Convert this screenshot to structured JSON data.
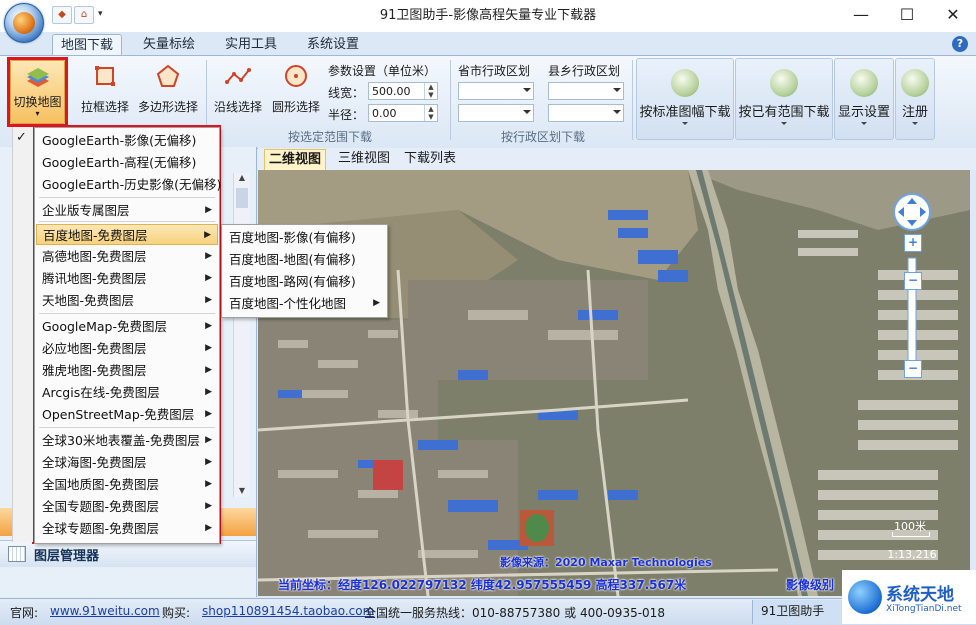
{
  "window": {
    "title": "91卫图助手-影像高程矢量专业下载器",
    "minimize": "—",
    "maximize": "☐",
    "close": "✕"
  },
  "tabs": [
    {
      "label": "地图下载",
      "active": true
    },
    {
      "label": "矢量标绘",
      "active": false
    },
    {
      "label": "实用工具",
      "active": false
    },
    {
      "label": "系统设置",
      "active": false
    }
  ],
  "ribbon": {
    "switch_map": "切换地图",
    "rect_select": "拉框选择",
    "polygon_select": "多边形选择",
    "line_select": "沿线选择",
    "circle_select": "圆形选择",
    "params_title": "参数设置（单位米）",
    "line_width_label": "线宽：",
    "line_width_value": "500.00",
    "radius_label": "半径：",
    "radius_value": "0.00",
    "group_range": "按选定范围下载",
    "province_label": "省市行政区划",
    "county_label": "县乡行政区划",
    "group_admin": "按行政区划下载",
    "btn_standard": "按标准图幅下载",
    "btn_existing": "按已有范围下载",
    "btn_display": "显示设置",
    "btn_logout": "注册"
  },
  "map_tabs": [
    "二维视图",
    "三维视图",
    "下载列表"
  ],
  "menu": {
    "items": [
      {
        "label": "GoogleEarth-影像(无偏移)",
        "checked": true,
        "submenu": false
      },
      {
        "label": "GoogleEarth-高程(无偏移)",
        "checked": false,
        "submenu": false
      },
      {
        "label": "GoogleEarth-历史影像(无偏移)",
        "checked": false,
        "submenu": false
      },
      {
        "label": "企业版专属图层",
        "checked": false,
        "submenu": true
      },
      {
        "label": "百度地图-免费图层",
        "checked": false,
        "submenu": true,
        "highlighted": true
      },
      {
        "label": "高德地图-免费图层",
        "checked": false,
        "submenu": true
      },
      {
        "label": "腾讯地图-免费图层",
        "checked": false,
        "submenu": true
      },
      {
        "label": "天地图-免费图层",
        "checked": false,
        "submenu": true
      },
      {
        "label": "GoogleMap-免费图层",
        "checked": false,
        "submenu": true
      },
      {
        "label": "必应地图-免费图层",
        "checked": false,
        "submenu": true
      },
      {
        "label": "雅虎地图-免费图层",
        "checked": false,
        "submenu": true
      },
      {
        "label": "Arcgis在线-免费图层",
        "checked": false,
        "submenu": true
      },
      {
        "label": "OpenStreetMap-免费图层",
        "checked": false,
        "submenu": true
      },
      {
        "label": "全球30米地表覆盖-免费图层",
        "checked": false,
        "submenu": true
      },
      {
        "label": "全球海图-免费图层",
        "checked": false,
        "submenu": true
      },
      {
        "label": "全国地质图-免费图层",
        "checked": false,
        "submenu": true
      },
      {
        "label": "全国专题图-免费图层",
        "checked": false,
        "submenu": true
      },
      {
        "label": "全球专题图-免费图层",
        "checked": false,
        "submenu": true
      }
    ],
    "check_mark": "✓",
    "arrow": "▶"
  },
  "submenu": {
    "items": [
      {
        "label": "百度地图-影像(有偏移)",
        "submenu": false
      },
      {
        "label": "百度地图-地图(有偏移)",
        "submenu": false
      },
      {
        "label": "百度地图-路网(有偏移)",
        "submenu": false
      },
      {
        "label": "百度地图-个性化地图",
        "submenu": true
      }
    ]
  },
  "left_panel": {
    "layer_manager": "图层管理器"
  },
  "map": {
    "image_source": "影像来源：2020 Maxar Technologies",
    "coords": "当前坐标：经度126.022797132 纬度42.957555459 高程337.567米",
    "zoom_level_label": "影像级别",
    "scale_label": "100米",
    "scale_ratio": "1:13,216",
    "zoom_in": "+",
    "zoom_out": "−"
  },
  "status": {
    "site_label": "官网:",
    "site_url": "www.91weitu.com",
    "buy_label": "购买:",
    "buy_url": "shop110891454.taobao.com",
    "hotline": "全国统一服务热线：010-88757380 或 400-0935-018",
    "taskbar_app": "91卫图助手"
  },
  "watermark": {
    "site": "系统天地",
    "domain": "XiTongTianDi.net"
  },
  "colors": {
    "accent": "#2f6cc0",
    "highlight": "#f7d27c",
    "red_outline": "#e0141e",
    "map_text": "#1a2fd8"
  }
}
